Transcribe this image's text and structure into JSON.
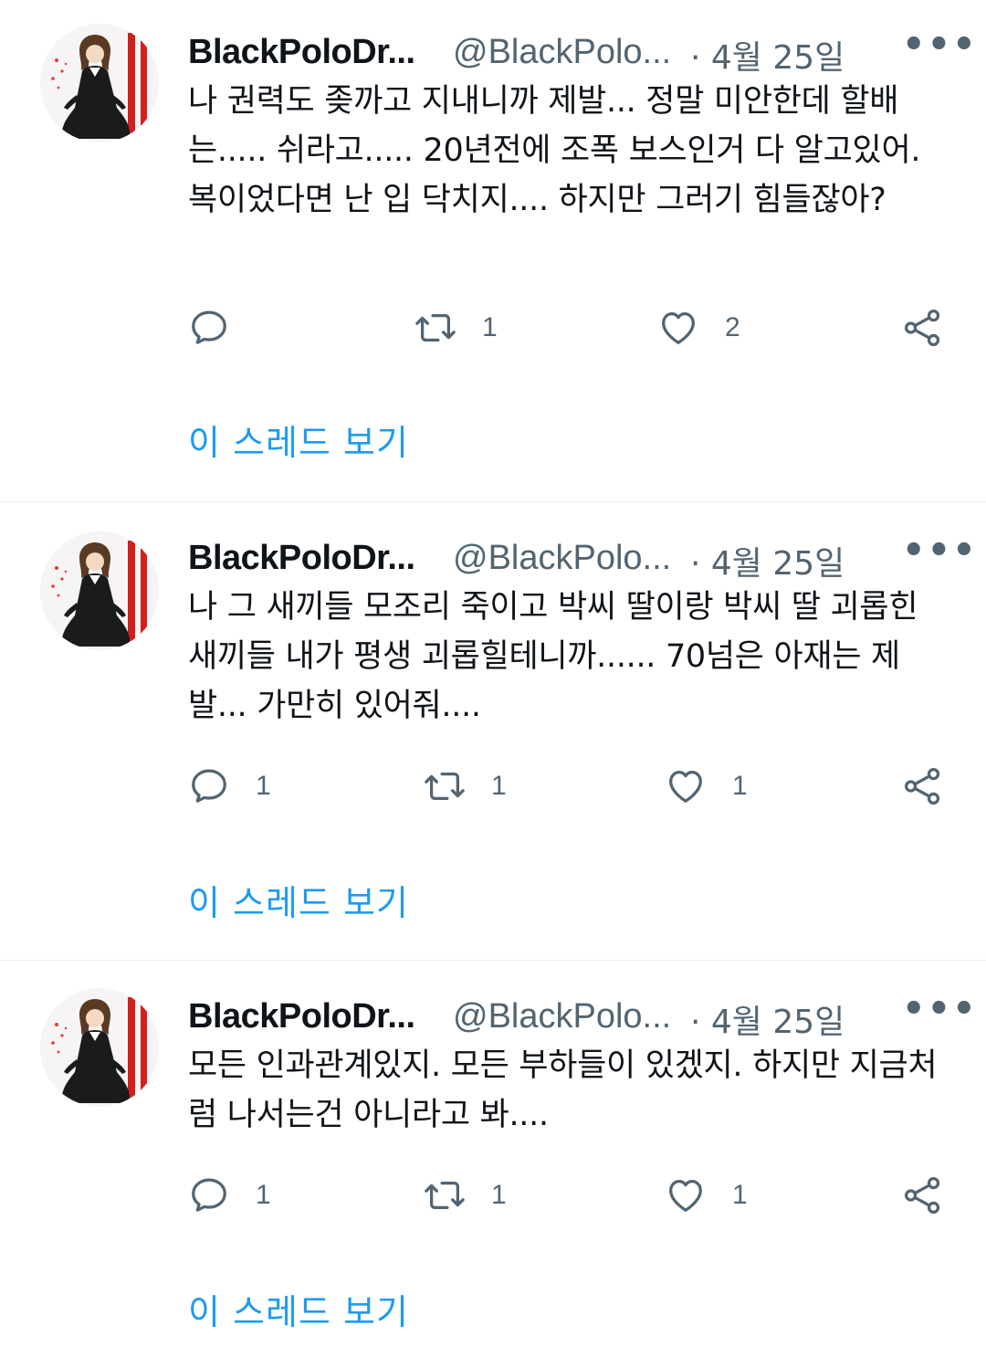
{
  "tweets": [
    {
      "name": "BlackPoloDr...",
      "handle": "@BlackPolo...",
      "date": "· 4월 25일",
      "more": "•••",
      "body": "나 권력도 좆까고 지내니까 제발... 정말 미안한데 할배는..... 쉬라고..... 20년전에 조폭 보스인거 다 알고있어. 복이었다면 난 입 닥치지.... 하지만 그러기 힘들잖아?",
      "replies": "",
      "retweets": "1",
      "likes": "2",
      "thread_link": "이 스레드 보기"
    },
    {
      "name": "BlackPoloDr...",
      "handle": "@BlackPolo...",
      "date": "· 4월 25일",
      "more": "•••",
      "body": "나 그 새끼들 모조리 죽이고 박씨 딸이랑 박씨 딸 괴롭힌 새끼들 내가 평생 괴롭힐테니까...... 70넘은 아재는 제발... 가만히 있어줘....",
      "replies": "1",
      "retweets": "1",
      "likes": "1",
      "thread_link": "이 스레드 보기"
    },
    {
      "name": "BlackPoloDr...",
      "handle": "@BlackPolo...",
      "date": "· 4월 25일",
      "more": "•••",
      "body": "모든 인과관계있지. 모든 부하들이 있겠지. 하지만 지금처럼 나서는건 아니라고 봐....",
      "replies": "1",
      "retweets": "1",
      "likes": "1",
      "thread_link": "이 스레드 보기"
    }
  ],
  "icons": {
    "reply": "reply-icon",
    "retweet": "retweet-icon",
    "like": "heart-icon",
    "share": "share-icon",
    "more": "more-icon"
  },
  "colors": {
    "text": "#0f1419",
    "secondary": "#536471",
    "link": "#1d9bf0",
    "divider": "#e6ecf0"
  }
}
